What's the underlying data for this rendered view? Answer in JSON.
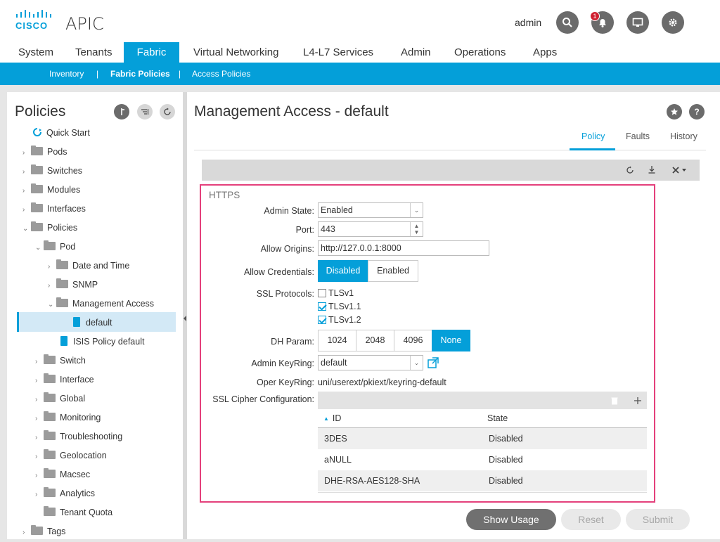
{
  "header": {
    "logo_text": "CISCO",
    "app_title": "APIC",
    "user": "admin",
    "notification_count": "1"
  },
  "main_nav": {
    "tabs": [
      {
        "label": "System"
      },
      {
        "label": "Tenants"
      },
      {
        "label": "Fabric"
      },
      {
        "label": "Virtual Networking"
      },
      {
        "label": "L4-L7 Services"
      },
      {
        "label": "Admin"
      },
      {
        "label": "Operations"
      },
      {
        "label": "Apps"
      }
    ],
    "active": "Fabric"
  },
  "sub_nav": {
    "items": [
      {
        "label": "Inventory"
      },
      {
        "label": "Fabric Policies"
      },
      {
        "label": "Access Policies"
      }
    ],
    "separator": "|",
    "active": "Fabric Policies"
  },
  "sidebar": {
    "title": "Policies",
    "tree": [
      {
        "label": "Quick Start"
      },
      {
        "label": "Pods"
      },
      {
        "label": "Switches"
      },
      {
        "label": "Modules"
      },
      {
        "label": "Interfaces"
      },
      {
        "label": "Policies"
      },
      {
        "label": "Pod"
      },
      {
        "label": "Date and Time"
      },
      {
        "label": "SNMP"
      },
      {
        "label": "Management Access"
      },
      {
        "label": "default"
      },
      {
        "label": "ISIS Policy default"
      },
      {
        "label": "Switch"
      },
      {
        "label": "Interface"
      },
      {
        "label": "Global"
      },
      {
        "label": "Monitoring"
      },
      {
        "label": "Troubleshooting"
      },
      {
        "label": "Geolocation"
      },
      {
        "label": "Macsec"
      },
      {
        "label": "Analytics"
      },
      {
        "label": "Tenant Quota"
      },
      {
        "label": "Tags"
      }
    ],
    "selected": "default"
  },
  "main": {
    "title": "Management Access - default",
    "tabs": [
      {
        "label": "Policy"
      },
      {
        "label": "Faults"
      },
      {
        "label": "History"
      }
    ],
    "active_tab": "Policy",
    "section": "HTTPS",
    "form": {
      "admin_state": {
        "label": "Admin State:",
        "value": "Enabled"
      },
      "port": {
        "label": "Port:",
        "value": "443"
      },
      "allow_origins": {
        "label": "Allow Origins:",
        "value": "http://127.0.0.1:8000"
      },
      "allow_credentials": {
        "label": "Allow Credentials:",
        "options": [
          "Disabled",
          "Enabled"
        ],
        "selected": "Disabled"
      },
      "ssl_protocols": {
        "label": "SSL Protocols:",
        "options": [
          {
            "label": "TLSv1",
            "checked": false
          },
          {
            "label": "TLSv1.1",
            "checked": true
          },
          {
            "label": "TLSv1.2",
            "checked": true
          }
        ]
      },
      "dh_param": {
        "label": "DH Param:",
        "options": [
          "1024",
          "2048",
          "4096",
          "None"
        ],
        "selected": "None"
      },
      "admin_keyring": {
        "label": "Admin KeyRing:",
        "value": "default"
      },
      "oper_keyring": {
        "label": "Oper KeyRing:",
        "value": "uni/userext/pkiext/keyring-default"
      },
      "ssl_cipher": {
        "label": "SSL Cipher Configuration:",
        "columns": [
          "ID",
          "State"
        ],
        "rows": [
          {
            "id": "3DES",
            "state": "Disabled"
          },
          {
            "id": "aNULL",
            "state": "Disabled"
          },
          {
            "id": "DHE-RSA-AES128-SHA",
            "state": "Disabled"
          }
        ]
      }
    },
    "buttons": {
      "show_usage": "Show Usage",
      "reset": "Reset",
      "submit": "Submit"
    }
  },
  "colors": {
    "accent": "#049fd9",
    "highlight_frame": "#e4407b",
    "badge": "#cf2030"
  }
}
